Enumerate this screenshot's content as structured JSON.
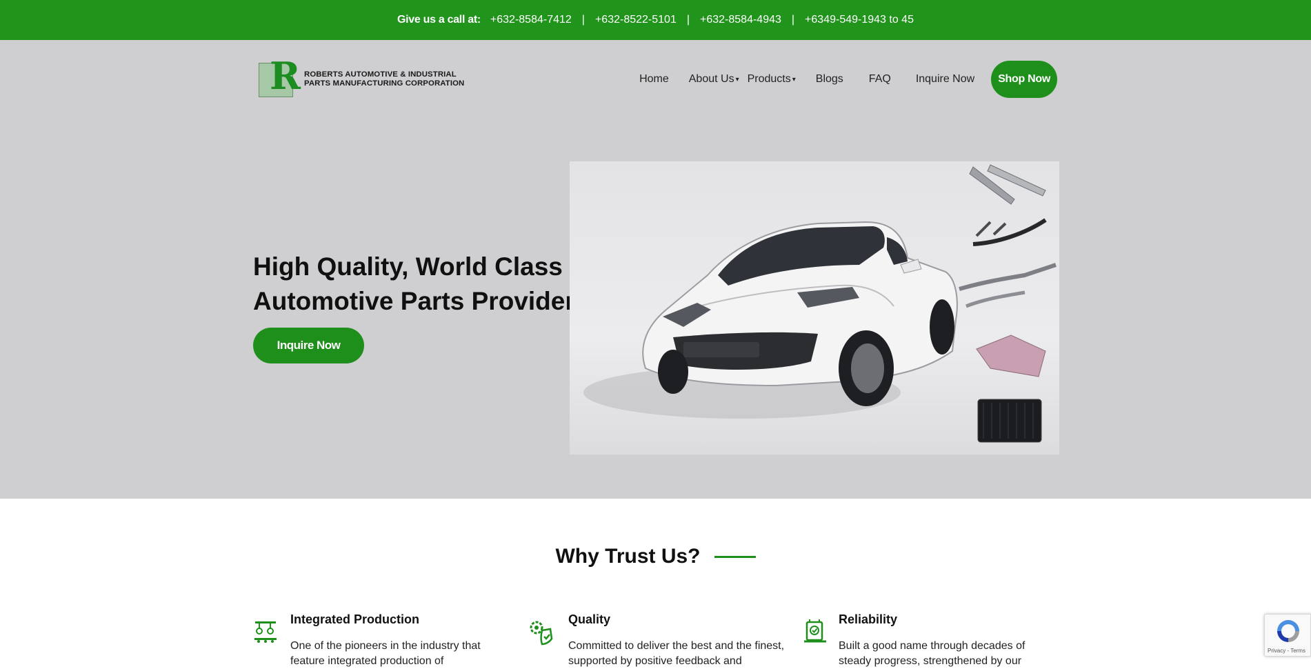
{
  "topbar": {
    "call_label": "Give us a call at:",
    "phones": [
      "+632-8584-7412",
      "+632-8522-5101",
      "+632-8584-4943",
      "+6349-549-1943 to 45"
    ],
    "separator": "|"
  },
  "logo": {
    "letter": "R",
    "line1": "ROBERTS AUTOMOTIVE & INDUSTRIAL",
    "line2": "PARTS MANUFACTURING CORPORATION"
  },
  "nav": {
    "home": "Home",
    "about": "About Us",
    "products": "Products",
    "blogs": "Blogs",
    "faq": "FAQ",
    "inquire": "Inquire Now",
    "shop": "Shop Now",
    "caret": "▾"
  },
  "hero": {
    "title": "High Quality, World Class Automotive Parts Provider",
    "button": "Inquire Now"
  },
  "trust": {
    "heading": "Why Trust Us?",
    "features": [
      {
        "title": "Integrated Production",
        "text": "One of the pioneers in the industry that feature integrated production of",
        "icon": "production-line-icon"
      },
      {
        "title": "Quality",
        "text": "Committed to deliver the best and the finest, supported by positive feedback and",
        "icon": "quality-badge-icon"
      },
      {
        "title": "Reliability",
        "text": "Built a good name through decades of steady progress, strengthened by our",
        "icon": "reliability-certificate-icon"
      }
    ]
  },
  "recaptcha": {
    "links": "Privacy - Terms"
  },
  "colors": {
    "brand_green": "#1f8f1c",
    "hero_bg": "#cfcfd2"
  }
}
